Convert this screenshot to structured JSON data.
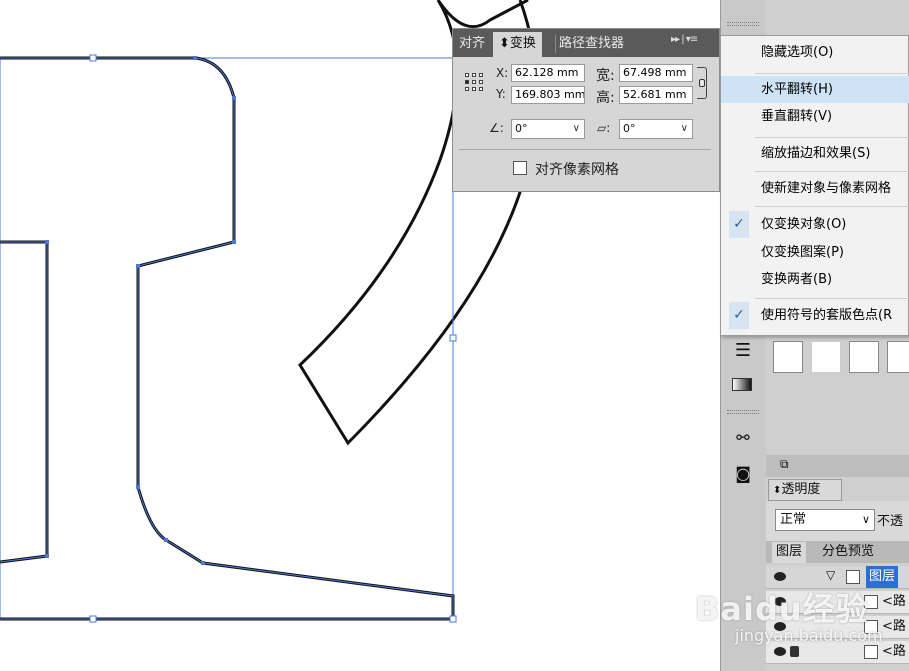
{
  "transform_panel": {
    "tabs": [
      "对齐",
      "变换",
      "路径查找器"
    ],
    "x_label": "X:",
    "x_value": "62.128 mm",
    "y_label": "Y:",
    "y_value": "169.803 mm",
    "w_label": "宽:",
    "w_value": "67.498 mm",
    "h_label": "高:",
    "h_value": "52.681 mm",
    "rotate_value": "0°",
    "shear_value": "0°",
    "align_pixel_label": "对齐像素网格",
    "align_pixel_checked": false,
    "panel_controls": "▸▸ | ▾≡"
  },
  "flyout_menu": {
    "items": [
      {
        "label": "隐藏选项(O)",
        "checked": false,
        "highlighted": false
      },
      {
        "label": "水平翻转(H)",
        "checked": false,
        "highlighted": true
      },
      {
        "label": "垂直翻转(V)",
        "checked": false,
        "highlighted": false
      },
      {
        "label": "缩放描边和效果(S)",
        "checked": false,
        "highlighted": false
      },
      {
        "label": "使新建对象与像素网格",
        "checked": false,
        "highlighted": false
      },
      {
        "label": "仅变换对象(O)",
        "checked": true,
        "highlighted": false
      },
      {
        "label": "仅变换图案(P)",
        "checked": false,
        "highlighted": false
      },
      {
        "label": "变换两者(B)",
        "checked": false,
        "highlighted": false
      },
      {
        "label": "使用符号的套版色点(R",
        "checked": true,
        "highlighted": false
      }
    ],
    "check_mark": "✓"
  },
  "transparency_panel": {
    "tab": "透明度",
    "blend_mode": "正常",
    "opacity_label": "不透"
  },
  "layers_panel": {
    "tabs": [
      "图层",
      "分色预览"
    ],
    "layer_name": "图层",
    "rows": [
      "<路",
      "<路",
      "<路"
    ]
  },
  "watermark": {
    "main": "Baidu经验",
    "sub": "jingyan.baidu.com"
  },
  "colors": {
    "selection_blue": "#4a78d4",
    "menu_highlight": "#cfe3f6",
    "panel_gray": "#d6d6d6",
    "tab_bar_dark": "#5a5a5a"
  }
}
